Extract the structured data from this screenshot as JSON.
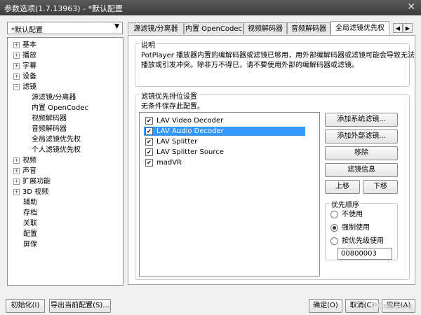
{
  "window": {
    "title": "参数选项(1.7.13963) - *默认配置"
  },
  "preset": {
    "value": "*默认配置"
  },
  "tree": [
    {
      "label": "基本",
      "expander": "+"
    },
    {
      "label": "播放",
      "expander": "+"
    },
    {
      "label": "字幕",
      "expander": "+"
    },
    {
      "label": "设备",
      "expander": "+"
    },
    {
      "label": "滤镜",
      "expander": "−"
    },
    {
      "label": "源滤镜/分离器"
    },
    {
      "label": "内置 OpenCodec"
    },
    {
      "label": "视频解码器"
    },
    {
      "label": "音频解码器"
    },
    {
      "label": "全局滤镜优先权"
    },
    {
      "label": "个人滤镜优先权"
    },
    {
      "label": "视频",
      "expander": "+"
    },
    {
      "label": "声音",
      "expander": "+"
    },
    {
      "label": "扩展功能",
      "expander": "+"
    },
    {
      "label": "3D 视频",
      "expander": "+"
    },
    {
      "label": "辅助"
    },
    {
      "label": "存档"
    },
    {
      "label": "关联"
    },
    {
      "label": "配置"
    },
    {
      "label": "屏保"
    }
  ],
  "tabs": [
    {
      "label": "源滤镜/分离器"
    },
    {
      "label": "内置 OpenCodec"
    },
    {
      "label": "视频解码器"
    },
    {
      "label": "音频解码器"
    },
    {
      "label": "全局滤镜优先权",
      "active": true
    }
  ],
  "tab_nav": {
    "prev": "◀",
    "next": "▶"
  },
  "description": {
    "legend": "说明",
    "line1": "PotPlayer 播放器内置的编解码器或滤镜已够用，用外部编解码器或滤镜可能会导致无法",
    "line2": "播放或引发冲突。除非万不得已，请不要使用外部的编解码器或滤镜。"
  },
  "priority": {
    "legend": "滤镜优先排位设置",
    "subtitle": "无条件保存此配置。",
    "filters": [
      {
        "name": "LAV Video Decoder",
        "checked": true
      },
      {
        "name": "LAV Audio Decoder",
        "checked": true,
        "selected": true
      },
      {
        "name": "LAV Splitter",
        "checked": true
      },
      {
        "name": "LAV Splitter Source",
        "checked": true
      },
      {
        "name": "madVR",
        "checked": true
      }
    ],
    "buttons": {
      "add_system": "添加系统滤镜...",
      "add_external": "添加外部滤镜...",
      "remove": "移除",
      "filter_info": "滤镜信息",
      "move_up": "上移",
      "move_down": "下移"
    },
    "order": {
      "legend": "优先顺序",
      "options": [
        {
          "label": "不使用",
          "selected": false
        },
        {
          "label": "强制使用",
          "selected": true
        },
        {
          "label": "按优先级使用",
          "selected": false
        }
      ],
      "value": "00800003"
    }
  },
  "footer": {
    "init": "初始化(I)",
    "export": "导出当前配置(S)...",
    "ok": "确定(O)",
    "cancel": "取消(C)",
    "apply": "应用(A)"
  },
  "watermark": "PConline",
  "colors": {
    "selection": "#3399ff",
    "titlebar": "#4a4a4a"
  }
}
